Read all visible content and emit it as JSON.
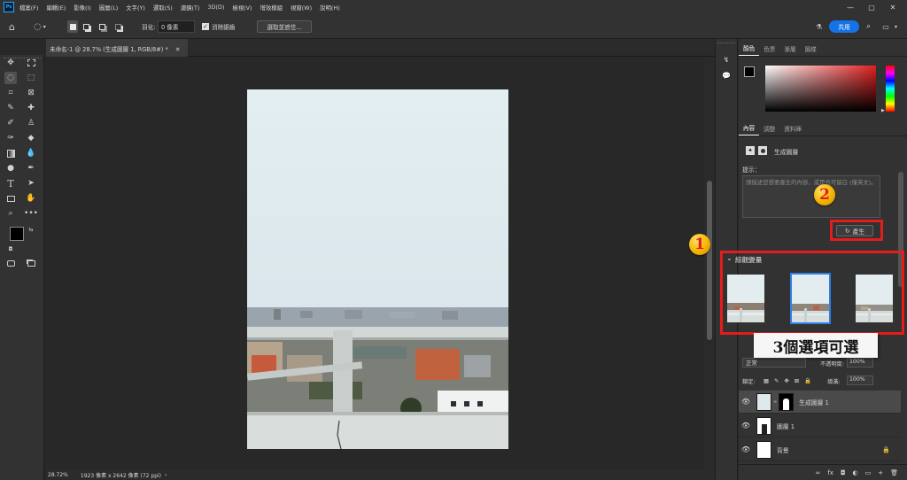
{
  "app": {
    "logo": "Ps"
  },
  "menu": {
    "items": [
      "檔案(F)",
      "編輯(E)",
      "影像(I)",
      "圖層(L)",
      "文字(Y)",
      "選取(S)",
      "濾鏡(T)",
      "3D(D)",
      "檢視(V)",
      "增效模組",
      "視窗(W)",
      "說明(H)"
    ]
  },
  "window_controls": {
    "minimize": "—",
    "maximize": "▢",
    "close": "✕"
  },
  "options": {
    "feather_label": "羽化:",
    "feather_value": "0 像素",
    "antialias_label": "消除鋸齒",
    "select_mask_button": "選取並遮住...",
    "share_button": "共用"
  },
  "document": {
    "tab_title": "未命名-1 @ 28.7% (生成圖層 1, RGB/8#) *",
    "tab_close": "✕"
  },
  "status": {
    "zoom": "28.72%",
    "dims": "1923 像素 x 2642 像素 (72 ppi)",
    "arrow": "›"
  },
  "color_panel": {
    "tabs": [
      "顏色",
      "色票",
      "漸層",
      "圖樣"
    ],
    "accent": "#e02020"
  },
  "properties": {
    "tabs": [
      "內容",
      "調整",
      "資料庫"
    ],
    "layer_kind": "生成圖層",
    "prompt_label": "提示：",
    "prompt_placeholder": "請描述您想要產生的內容，或是也可留白 (僅英文)。",
    "generate_button": "產生",
    "variations_label": "綜觀變量"
  },
  "layers": {
    "blend_mode": "正常",
    "opacity_label": "不透明度:",
    "opacity_value": "100%",
    "lock_label": "鎖定:",
    "fill_label": "填滿:",
    "fill_value": "100%",
    "rows": [
      {
        "name": "生成圖層 1",
        "selected": true
      },
      {
        "name": "圖層 1",
        "selected": false
      },
      {
        "name": "背景",
        "selected": false
      }
    ],
    "footer_icons": [
      "∞",
      "fx",
      "◘",
      "◐",
      "▭",
      "+",
      "🗑"
    ]
  },
  "annotations": {
    "badge1": "1",
    "badge2": "2",
    "callout": "3個選項可選",
    "color": "#e51c1c"
  }
}
